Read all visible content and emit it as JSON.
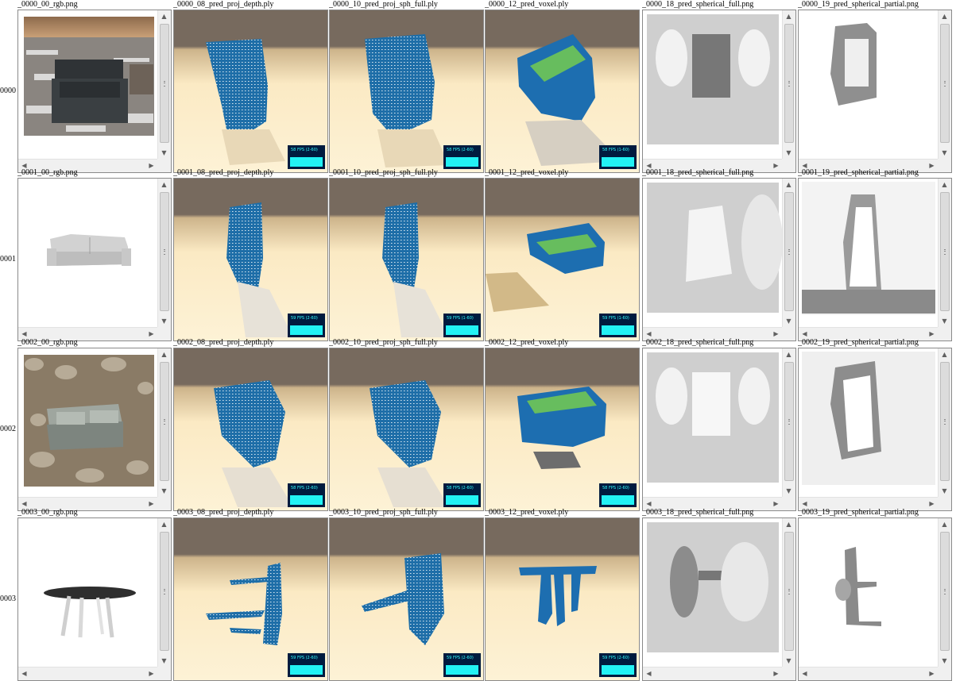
{
  "colors": {
    "background": "#ffffff",
    "cell_border": "#8a8a8a",
    "scrollbar": "#f0f0f0",
    "fps_panel": "#001b3f",
    "fps_bar": "#22f2f4",
    "point_cloud": "#1e6ea8",
    "voxel_highlight": "#7ad14a"
  },
  "scroll_arrows": {
    "up": "▲",
    "down": "▼",
    "left": "◀",
    "right": "▶"
  },
  "rows": [
    {
      "label": "0000",
      "cells": [
        {
          "caption": "_0000_00_rgb.png",
          "kind": "rgb"
        },
        {
          "caption": "_0000_08_pred_proj_depth.ply",
          "kind": "ply",
          "fps": "58 FPS (2-60)"
        },
        {
          "caption": "_0000_10_pred_proj_sph_full.ply",
          "kind": "ply",
          "fps": "58 FPS (2-60)"
        },
        {
          "caption": "_0000_12_pred_voxel.ply",
          "kind": "voxel",
          "fps": "58 FPS (1-60)"
        },
        {
          "caption": "_0000_18_pred_spherical_full.png",
          "kind": "depth"
        },
        {
          "caption": "_0000_19_pred_spherical_partial.png",
          "kind": "partial"
        }
      ]
    },
    {
      "label": "0001",
      "cells": [
        {
          "caption": "_0001_00_rgb.png",
          "kind": "rgb"
        },
        {
          "caption": "_0001_08_pred_proj_depth.ply",
          "kind": "ply",
          "fps": "59 FPS (2-60)"
        },
        {
          "caption": "_0001_10_pred_proj_sph_full.ply",
          "kind": "ply",
          "fps": "59 FPS (1-60)"
        },
        {
          "caption": "_0001_12_pred_voxel.ply",
          "kind": "voxel",
          "fps": "59 FPS (1-60)"
        },
        {
          "caption": "_0001_18_pred_spherical_full.png",
          "kind": "depth"
        },
        {
          "caption": "_0001_19_pred_spherical_partial.png",
          "kind": "partial"
        }
      ]
    },
    {
      "label": "0002",
      "cells": [
        {
          "caption": "_0002_00_rgb.png",
          "kind": "rgb"
        },
        {
          "caption": "_0002_08_pred_proj_depth.ply",
          "kind": "ply",
          "fps": "58 FPS (2-60)"
        },
        {
          "caption": "_0002_10_pred_proj_sph_full.ply",
          "kind": "ply",
          "fps": "58 FPS (2-60)"
        },
        {
          "caption": "_0002_12_pred_voxel.ply",
          "kind": "voxel",
          "fps": "58 FPS (2-60)"
        },
        {
          "caption": "_0002_18_pred_spherical_full.png",
          "kind": "depth"
        },
        {
          "caption": "_0002_19_pred_spherical_partial.png",
          "kind": "partial"
        }
      ]
    },
    {
      "label": "0003",
      "cells": [
        {
          "caption": "_0003_00_rgb.png",
          "kind": "rgb"
        },
        {
          "caption": "_0003_08_pred_proj_depth.ply",
          "kind": "ply",
          "fps": "59 FPS (2-60)"
        },
        {
          "caption": "_0003_10_pred_proj_sph_full.ply",
          "kind": "ply",
          "fps": "59 FPS (2-60)"
        },
        {
          "caption": "_0003_12_pred_voxel.ply",
          "kind": "voxel",
          "fps": "59 FPS (2-60)"
        },
        {
          "caption": "_0003_18_pred_spherical_full.png",
          "kind": "depth"
        },
        {
          "caption": "_0003_19_pred_spherical_partial.png",
          "kind": "partial"
        }
      ]
    }
  ]
}
